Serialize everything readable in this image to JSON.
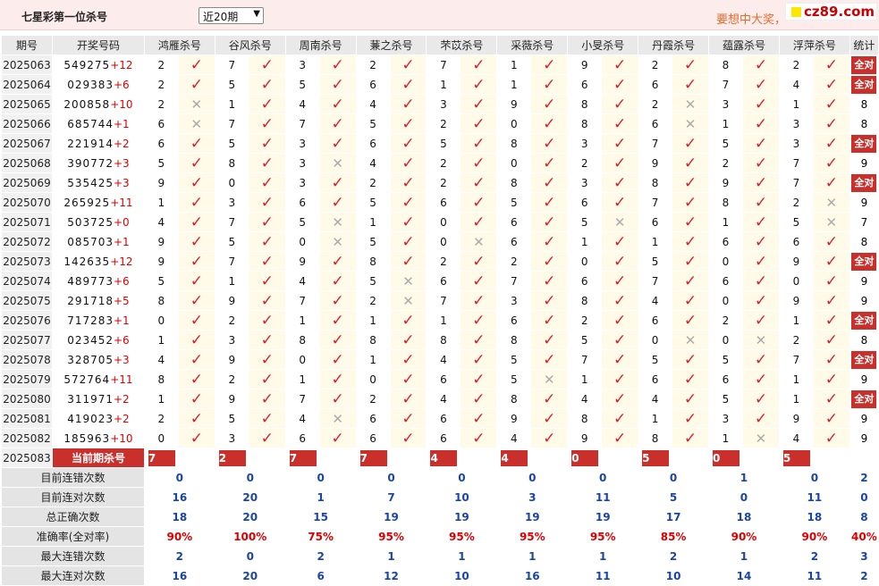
{
  "header": {
    "title": "七星彩第一位杀号",
    "select_value": "近20期",
    "promo_text": "要想中大奖，",
    "watermark": "cz89.com"
  },
  "columns": {
    "period": "期号",
    "numbers": "开奖号码",
    "experts": [
      "鸿雁杀号",
      "谷风杀号",
      "周南杀号",
      "蒹之杀号",
      "芣苡杀号",
      "采薇杀号",
      "小旻杀号",
      "丹霞杀号",
      "蕴露杀号",
      "浮萍杀号"
    ],
    "stat": "统计"
  },
  "all_correct_label": "全对",
  "rows": [
    {
      "period": "2025063",
      "numbers": "549275",
      "plus": "+12",
      "kills": [
        2,
        7,
        3,
        2,
        7,
        1,
        9,
        2,
        8,
        2
      ],
      "ok": [
        1,
        1,
        1,
        1,
        1,
        1,
        1,
        1,
        1,
        1
      ],
      "stat": "全对"
    },
    {
      "period": "2025064",
      "numbers": "029383",
      "plus": "+6",
      "kills": [
        2,
        5,
        5,
        6,
        1,
        1,
        6,
        6,
        7,
        4
      ],
      "ok": [
        1,
        1,
        1,
        1,
        1,
        1,
        1,
        1,
        1,
        1
      ],
      "stat": "全对"
    },
    {
      "period": "2025065",
      "numbers": "200858",
      "plus": "+10",
      "kills": [
        2,
        1,
        4,
        4,
        3,
        9,
        8,
        2,
        3,
        1
      ],
      "ok": [
        0,
        1,
        1,
        1,
        1,
        1,
        1,
        0,
        1,
        1
      ],
      "stat": "8"
    },
    {
      "period": "2025066",
      "numbers": "685744",
      "plus": "+1",
      "kills": [
        6,
        7,
        7,
        5,
        2,
        0,
        8,
        6,
        1,
        3
      ],
      "ok": [
        0,
        1,
        1,
        1,
        1,
        1,
        1,
        0,
        1,
        1
      ],
      "stat": "8"
    },
    {
      "period": "2025067",
      "numbers": "221914",
      "plus": "+2",
      "kills": [
        6,
        5,
        3,
        6,
        5,
        8,
        3,
        7,
        5,
        3
      ],
      "ok": [
        1,
        1,
        1,
        1,
        1,
        1,
        1,
        1,
        1,
        1
      ],
      "stat": "全对"
    },
    {
      "period": "2025068",
      "numbers": "390772",
      "plus": "+3",
      "kills": [
        5,
        8,
        3,
        4,
        2,
        0,
        2,
        9,
        2,
        7
      ],
      "ok": [
        1,
        1,
        0,
        1,
        1,
        1,
        1,
        1,
        1,
        1
      ],
      "stat": "9"
    },
    {
      "period": "2025069",
      "numbers": "535425",
      "plus": "+3",
      "kills": [
        9,
        0,
        3,
        2,
        2,
        8,
        3,
        8,
        9,
        7
      ],
      "ok": [
        1,
        1,
        1,
        1,
        1,
        1,
        1,
        1,
        1,
        1
      ],
      "stat": "全对"
    },
    {
      "period": "2025070",
      "numbers": "265925",
      "plus": "+11",
      "kills": [
        1,
        3,
        6,
        5,
        6,
        5,
        6,
        7,
        8,
        2
      ],
      "ok": [
        1,
        1,
        1,
        1,
        1,
        1,
        1,
        1,
        1,
        0
      ],
      "stat": "9"
    },
    {
      "period": "2025071",
      "numbers": "503725",
      "plus": "+0",
      "kills": [
        4,
        7,
        5,
        1,
        0,
        6,
        5,
        6,
        1,
        5
      ],
      "ok": [
        1,
        1,
        0,
        1,
        1,
        1,
        0,
        1,
        1,
        0
      ],
      "stat": "7"
    },
    {
      "period": "2025072",
      "numbers": "085703",
      "plus": "+1",
      "kills": [
        9,
        5,
        0,
        5,
        0,
        6,
        1,
        1,
        6,
        6
      ],
      "ok": [
        1,
        1,
        0,
        1,
        0,
        1,
        1,
        1,
        1,
        1
      ],
      "stat": "8"
    },
    {
      "period": "2025073",
      "numbers": "142635",
      "plus": "+12",
      "kills": [
        9,
        7,
        9,
        8,
        2,
        2,
        0,
        5,
        0,
        9
      ],
      "ok": [
        1,
        1,
        1,
        1,
        1,
        1,
        1,
        1,
        1,
        1
      ],
      "stat": "全对"
    },
    {
      "period": "2025074",
      "numbers": "489773",
      "plus": "+6",
      "kills": [
        5,
        1,
        4,
        5,
        6,
        7,
        6,
        7,
        6,
        0
      ],
      "ok": [
        1,
        1,
        1,
        0,
        1,
        1,
        1,
        1,
        1,
        1
      ],
      "stat": "9"
    },
    {
      "period": "2025075",
      "numbers": "291718",
      "plus": "+5",
      "kills": [
        8,
        9,
        7,
        2,
        7,
        3,
        8,
        4,
        0,
        9
      ],
      "ok": [
        1,
        1,
        1,
        0,
        1,
        1,
        1,
        1,
        1,
        1
      ],
      "stat": "9"
    },
    {
      "period": "2025076",
      "numbers": "717283",
      "plus": "+1",
      "kills": [
        0,
        2,
        1,
        1,
        1,
        6,
        2,
        6,
        2,
        1
      ],
      "ok": [
        1,
        1,
        1,
        1,
        1,
        1,
        1,
        1,
        1,
        1
      ],
      "stat": "全对"
    },
    {
      "period": "2025077",
      "numbers": "023452",
      "plus": "+6",
      "kills": [
        1,
        3,
        8,
        8,
        8,
        8,
        5,
        0,
        0,
        2
      ],
      "ok": [
        1,
        1,
        1,
        1,
        1,
        1,
        1,
        0,
        0,
        1
      ],
      "stat": "8"
    },
    {
      "period": "2025078",
      "numbers": "328705",
      "plus": "+3",
      "kills": [
        4,
        9,
        0,
        1,
        4,
        5,
        7,
        5,
        5,
        7
      ],
      "ok": [
        1,
        1,
        1,
        1,
        1,
        1,
        1,
        1,
        1,
        1
      ],
      "stat": "全对"
    },
    {
      "period": "2025079",
      "numbers": "572764",
      "plus": "+11",
      "kills": [
        8,
        2,
        1,
        0,
        6,
        5,
        1,
        6,
        6,
        1
      ],
      "ok": [
        1,
        1,
        1,
        1,
        1,
        0,
        1,
        1,
        1,
        1
      ],
      "stat": "9"
    },
    {
      "period": "2025080",
      "numbers": "311971",
      "plus": "+2",
      "kills": [
        1,
        9,
        7,
        2,
        4,
        8,
        4,
        4,
        5,
        1
      ],
      "ok": [
        1,
        1,
        1,
        1,
        1,
        1,
        1,
        1,
        1,
        1
      ],
      "stat": "全对"
    },
    {
      "period": "2025081",
      "numbers": "419023",
      "plus": "+2",
      "kills": [
        2,
        5,
        4,
        6,
        6,
        9,
        8,
        1,
        3,
        9
      ],
      "ok": [
        1,
        1,
        0,
        1,
        1,
        1,
        1,
        1,
        1,
        1
      ],
      "stat": "9"
    },
    {
      "period": "2025082",
      "numbers": "185963",
      "plus": "+10",
      "kills": [
        0,
        3,
        6,
        6,
        6,
        4,
        9,
        8,
        1,
        4
      ],
      "ok": [
        1,
        1,
        1,
        1,
        1,
        1,
        1,
        1,
        0,
        1
      ],
      "stat": "9"
    }
  ],
  "current": {
    "period": "2025083",
    "label": "当前期杀号",
    "kills": [
      "7",
      "2",
      "7",
      "7",
      "4",
      "4",
      "0",
      "5",
      "0",
      "5"
    ]
  },
  "stats": [
    {
      "label": "目前连错次数",
      "values": [
        "0",
        "0",
        "0",
        "0",
        "0",
        "0",
        "0",
        "0",
        "1",
        "0"
      ],
      "total": "2",
      "type": "v"
    },
    {
      "label": "目前连对次数",
      "values": [
        "16",
        "20",
        "1",
        "7",
        "10",
        "3",
        "11",
        "5",
        "0",
        "11"
      ],
      "total": "0",
      "type": "v"
    },
    {
      "label": "总正确次数",
      "values": [
        "18",
        "20",
        "15",
        "19",
        "19",
        "19",
        "19",
        "17",
        "18",
        "18"
      ],
      "total": "8",
      "type": "v"
    },
    {
      "label": "准确率(全对率)",
      "values": [
        "90%",
        "100%",
        "75%",
        "95%",
        "95%",
        "95%",
        "95%",
        "85%",
        "90%",
        "90%"
      ],
      "total": "40%",
      "type": "r"
    },
    {
      "label": "最大连错次数",
      "values": [
        "2",
        "0",
        "2",
        "1",
        "1",
        "1",
        "1",
        "2",
        "1",
        "2"
      ],
      "total": "3",
      "type": "v"
    },
    {
      "label": "最大连对次数",
      "values": [
        "16",
        "20",
        "6",
        "12",
        "10",
        "16",
        "11",
        "10",
        "14",
        "11"
      ],
      "total": "2",
      "type": "v"
    }
  ]
}
